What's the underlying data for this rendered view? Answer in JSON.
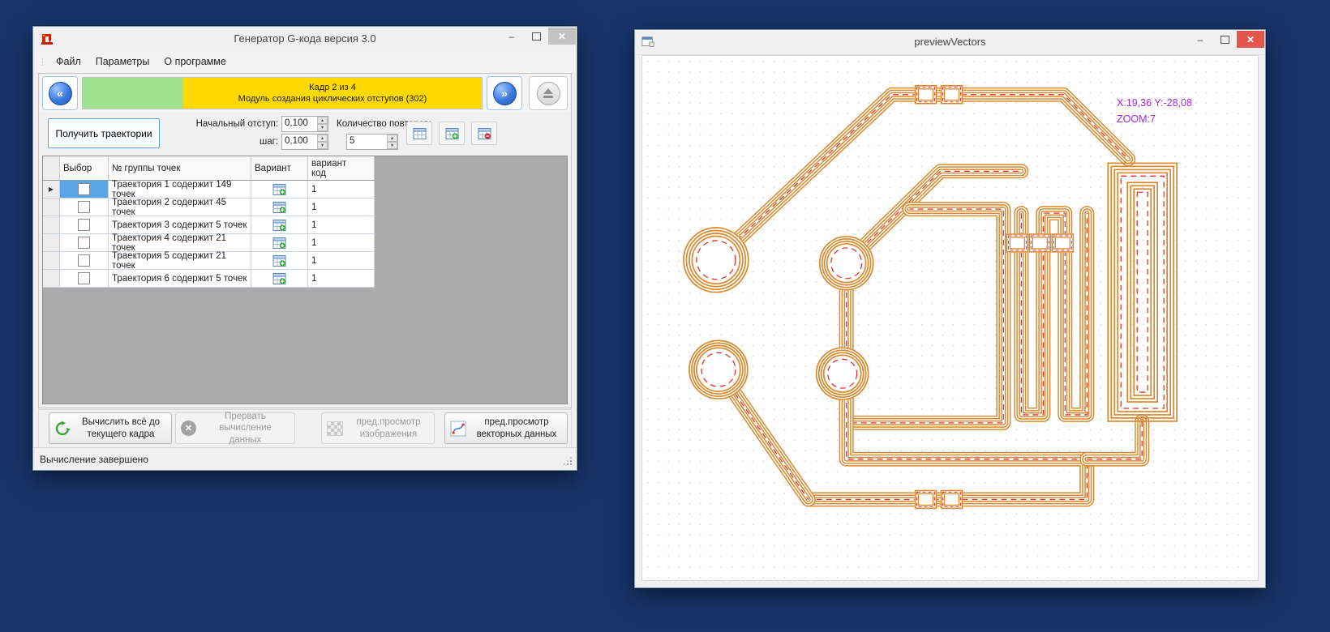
{
  "left_window": {
    "title": "Генератор G-кода версия 3.0",
    "menu": {
      "file": "Файл",
      "params": "Параметры",
      "about": "О программе"
    },
    "progress": {
      "frame": "Кадр 2 из 4",
      "module": "Модуль создания циклических отступов (302)"
    },
    "toolbar2": {
      "get_trajectories": "Получить траектории",
      "initial_offset_label": "Начальный отступ:",
      "step_label": "шаг:",
      "initial_offset_value": "0,100",
      "step_value": "0,100",
      "repeats_label": "Количество повторов:",
      "repeats_value": "5"
    },
    "grid": {
      "col_select": "Выбор",
      "col_group": "№ группы точек",
      "col_variant": "Вариант",
      "col_vcode_1": "вариант",
      "col_vcode_2": "код",
      "rows": [
        {
          "name": "Траектория 1 содержит 149 точек",
          "code": "1"
        },
        {
          "name": "Траектория 2 содержит 45 точек",
          "code": "1"
        },
        {
          "name": "Траектория 3 содержит 5 точек",
          "code": "1"
        },
        {
          "name": "Траектория 4 содержит 21 точек",
          "code": "1"
        },
        {
          "name": "Траектория 5 содержит 21 точек",
          "code": "1"
        },
        {
          "name": "Траектория 6 содержит 5 точек",
          "code": "1"
        }
      ]
    },
    "actions": {
      "calc_all_1": "Вычислить всё до",
      "calc_all_2": "текущего кадра",
      "abort_1": "Прервать вычисление",
      "abort_2": "данных",
      "preview_img_1": "пред.просмотр",
      "preview_img_2": "изображения",
      "preview_vec_1": "пред.просмотр",
      "preview_vec_2": "векторных данных"
    },
    "status": "Вычисление завершено"
  },
  "right_window": {
    "title": "previewVectors",
    "overlay": {
      "coords": "X:19,36 Y:-28,08",
      "zoom": "ZOOM:7"
    },
    "colors": {
      "trace": "#d8892d",
      "centerline": "#e23333",
      "overlay_text": "#a428e0"
    }
  }
}
